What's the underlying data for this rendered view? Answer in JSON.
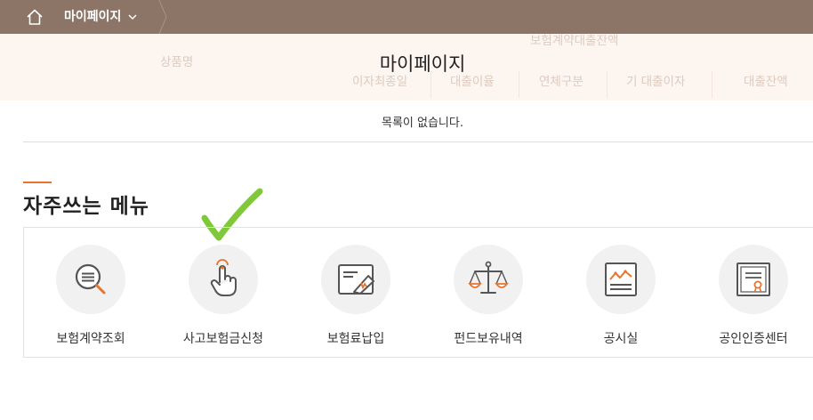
{
  "header": {
    "breadcrumb": "마이페이지"
  },
  "background_table": {
    "top_header": "보험계약대출잔액",
    "columns": [
      "상품명",
      "이자최종일",
      "대출이율",
      "연체구분",
      "기 대출이자",
      "대출잔액"
    ]
  },
  "page": {
    "title": "마이페이지",
    "empty_message": "목록이 없습니다."
  },
  "quick_menu": {
    "title": "자주쓰는 메뉴",
    "items": [
      {
        "label": "보험계약조회",
        "icon": "magnifier-icon"
      },
      {
        "label": "사고보험금신청",
        "icon": "pointing-hand-icon"
      },
      {
        "label": "보험료납입",
        "icon": "card-payment-icon"
      },
      {
        "label": "펀드보유내역",
        "icon": "balance-scale-icon"
      },
      {
        "label": "공시실",
        "icon": "chart-board-icon"
      },
      {
        "label": "공인인증센터",
        "icon": "certificate-icon"
      }
    ]
  },
  "colors": {
    "topbar": "#8c7466",
    "band": "#fdf5f0",
    "accent": "#e6742f",
    "check": "#7ec83a"
  }
}
